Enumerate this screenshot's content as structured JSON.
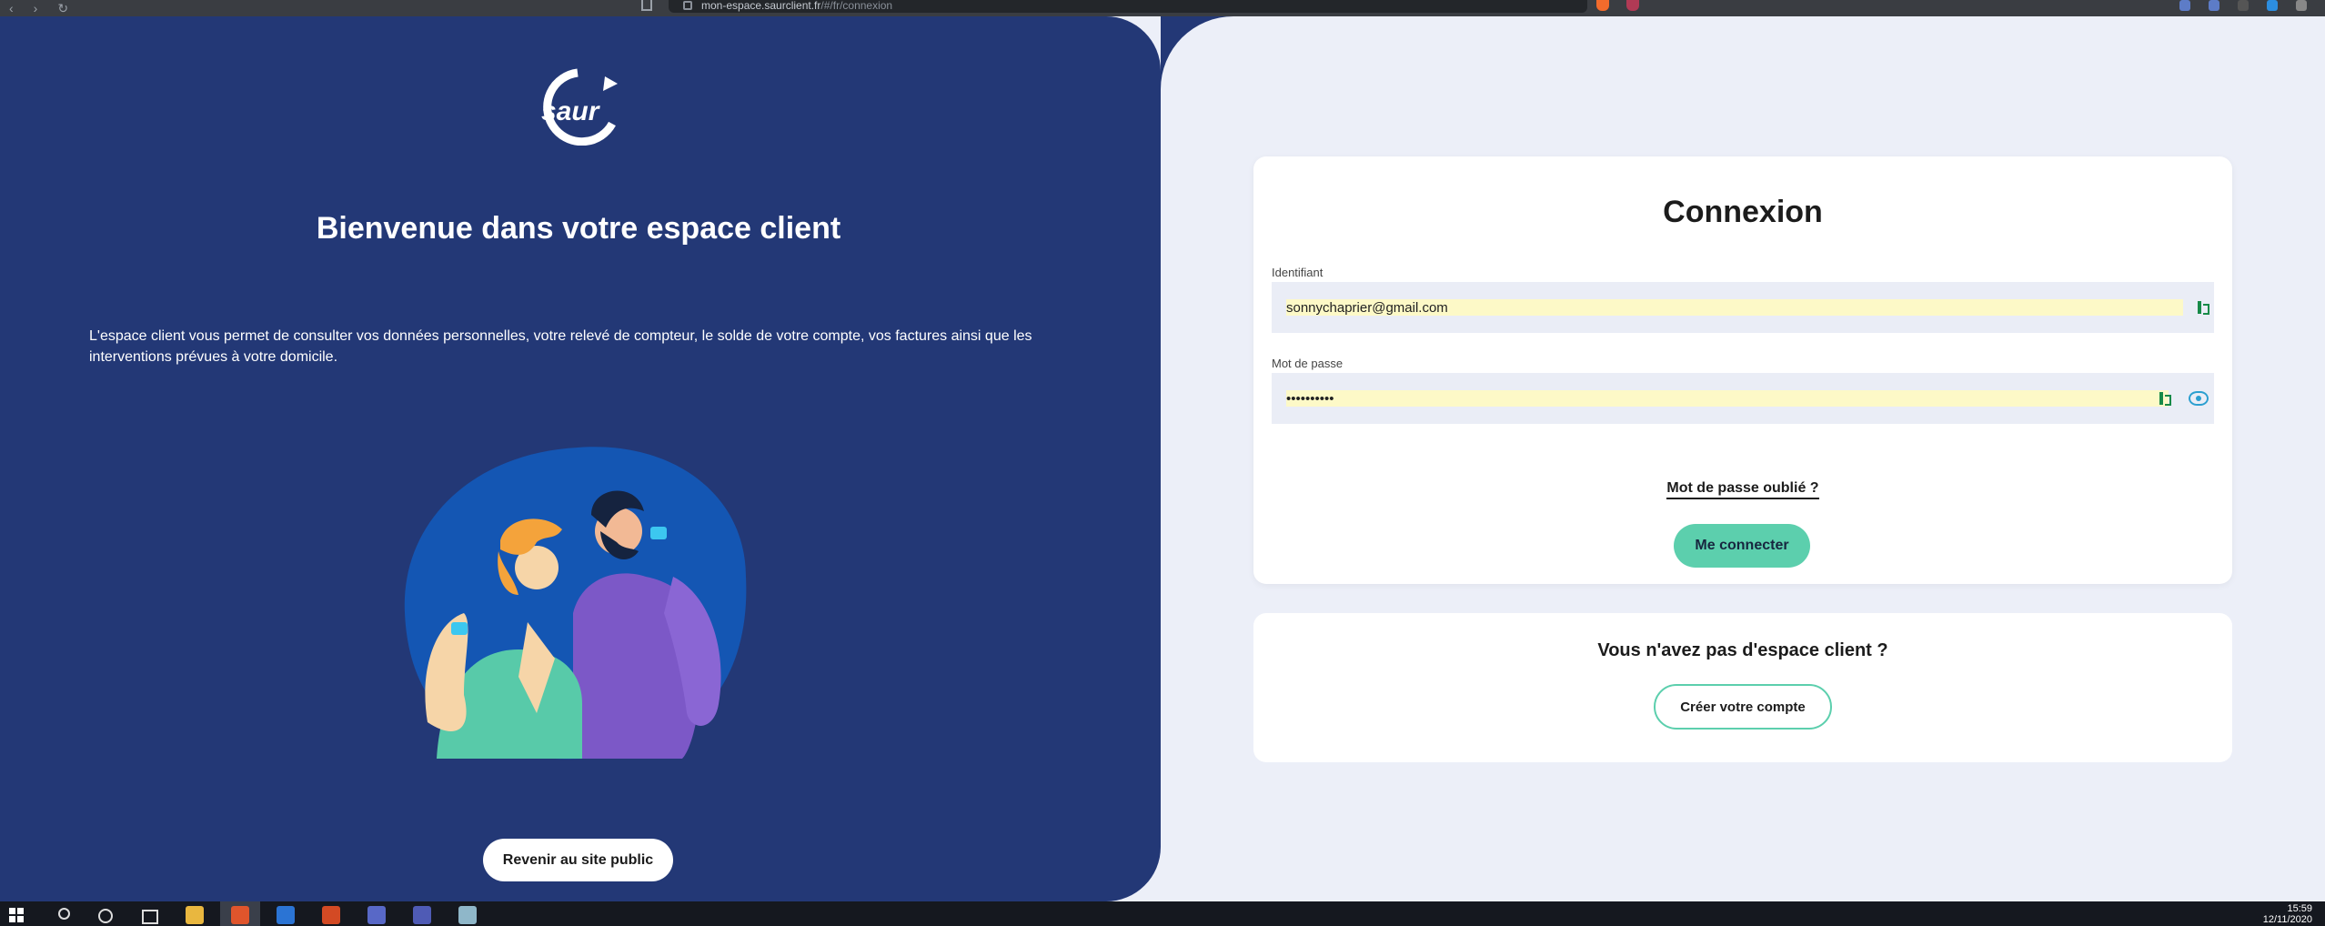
{
  "browser": {
    "url_domain": "mon-espace.saurclient.fr",
    "url_path": "/#/fr/connexion"
  },
  "left": {
    "logo_text": "saur",
    "title": "Bienvenue dans votre espace client",
    "intro": "L'espace client vous permet de consulter vos données personnelles, votre relevé de compteur, le solde de votre compte, vos factures ainsi que les interventions prévues à votre domicile.",
    "public_button": "Revenir au site public"
  },
  "login": {
    "title": "Connexion",
    "identifiant_label": "Identifiant",
    "identifiant_value": "sonnychaprier@gmail.com",
    "password_label": "Mot de passe",
    "password_value": "••••••••••",
    "forgot_link": "Mot de passe oublié ?",
    "connect_button": "Me connecter"
  },
  "signup": {
    "title": "Vous n'avez pas d'espace client ?",
    "create_button": "Créer votre compte"
  },
  "taskbar": {
    "time": "15:59",
    "date": "12/11/2020"
  },
  "colors": {
    "brand_blue": "#233876",
    "accent_green": "#5ccfad",
    "background": "#eceff8"
  }
}
